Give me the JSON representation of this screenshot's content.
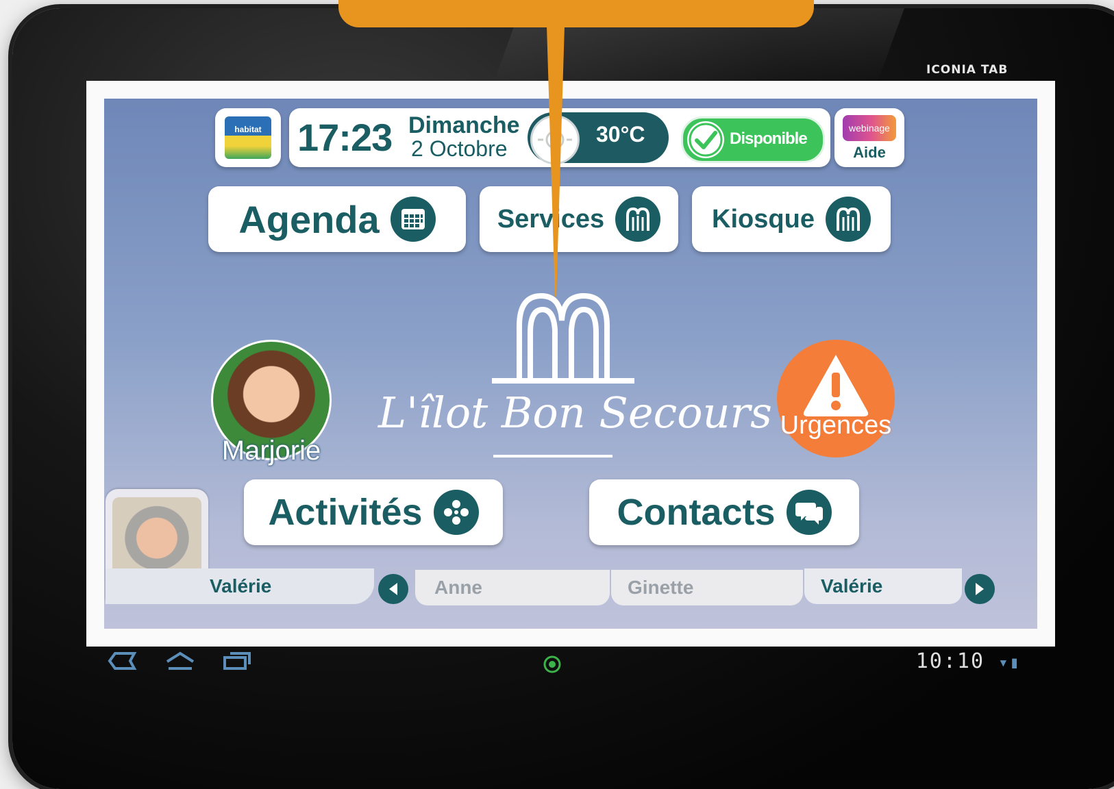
{
  "device": {
    "brand": "ICONIA TAB"
  },
  "header": {
    "logo_text": "habitat",
    "time": "17:23",
    "day": "Dimanche",
    "date": "2 Octobre",
    "temperature": "30°C",
    "availability": "Disponible",
    "help_badge": "webinage",
    "help_label": "Aide"
  },
  "menu": {
    "agenda": "Agenda",
    "services": "Services",
    "kiosque": "Kiosque",
    "activites": "Activités",
    "contacts": "Contacts"
  },
  "center": {
    "title": "L'îlot Bon Secours"
  },
  "contact_left": {
    "name": "Marjorie"
  },
  "emergency": {
    "label": "Urgences"
  },
  "footer": {
    "current_user": "Valérie",
    "tabs": [
      "Anne",
      "Ginette",
      "Valérie"
    ]
  },
  "system_bar": {
    "clock": "10:10"
  },
  "colors": {
    "teal": "#1a5e63",
    "screen_top": "#6f87b8",
    "available_green": "#3cc35a",
    "emergency_orange": "#f47d3a",
    "callout_orange": "#e8951f"
  }
}
